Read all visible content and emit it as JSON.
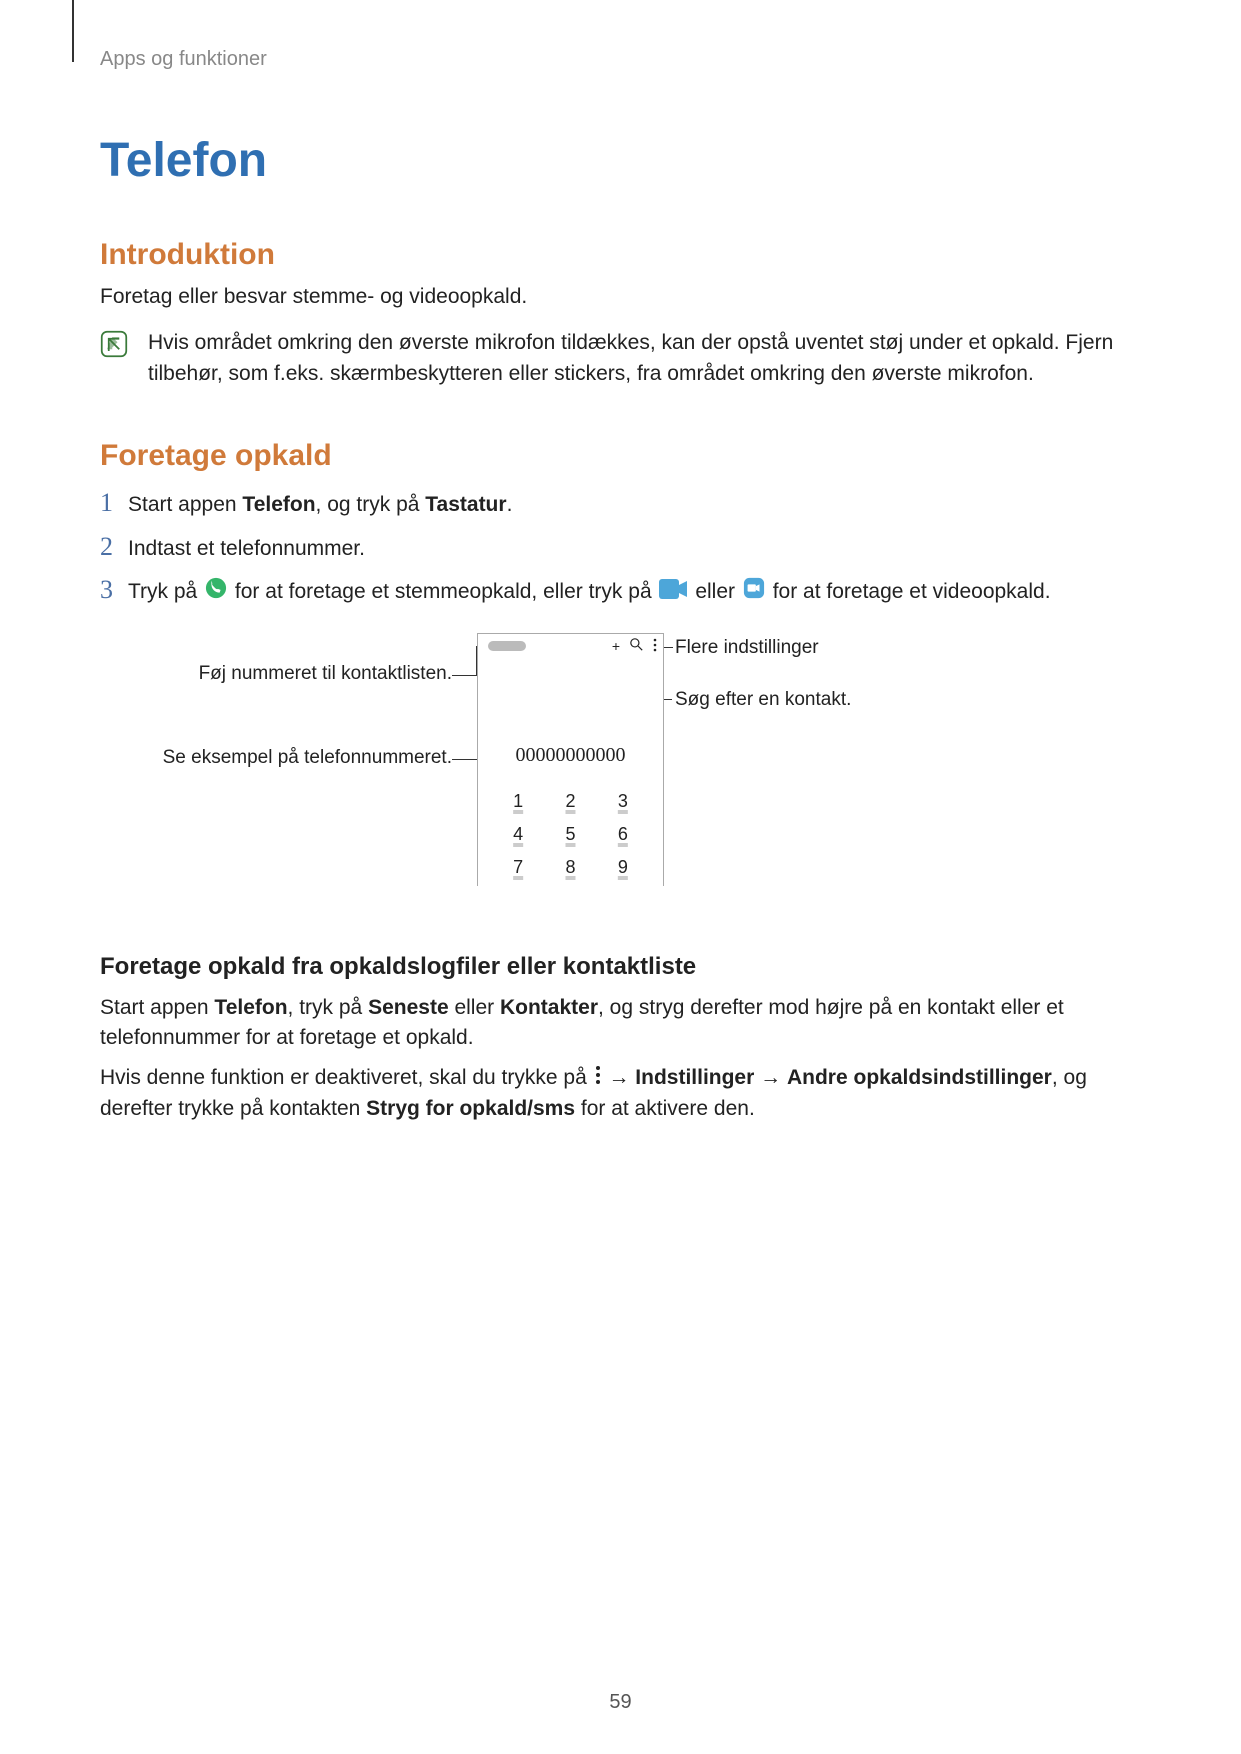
{
  "breadcrumb": "Apps og funktioner",
  "title": "Telefon",
  "section_intro": {
    "heading": "Introduktion",
    "lead": "Foretag eller besvar stemme- og videoopkald.",
    "note": "Hvis området omkring den øverste mikrofon tildækkes, kan der opstå uventet støj under et opkald. Fjern tilbehør, som f.eks. skærmbeskytteren eller stickers, fra området omkring den øverste mikrofon."
  },
  "section_make_call": {
    "heading": "Foretage opkald",
    "steps": [
      {
        "num": "1",
        "pre": "Start appen ",
        "bold1": "Telefon",
        "mid1": ", og tryk på ",
        "bold2": "Tastatur",
        "end": "."
      },
      {
        "num": "2",
        "text": "Indtast et telefonnummer."
      },
      {
        "num": "3",
        "pre": "Tryk på ",
        "after_call_icon": " for at foretage et stemmeopkald, eller tryk på ",
        "after_video1": " eller ",
        "after_video2": " for at foretage et videoopkald."
      }
    ]
  },
  "diagram": {
    "label_add_contact": "Føj nummeret til kontaktlisten.",
    "label_preview_number": "Se eksempel på telefonnummeret.",
    "label_more_options": "Flere indstillinger",
    "label_search_contact": "Søg efter en kontakt.",
    "displayed_number": "00000000000",
    "topbar": {
      "plus": "+",
      "search": "search-icon",
      "menu": "more-icon"
    },
    "keys": [
      "1",
      "2",
      "3",
      "4",
      "5",
      "6",
      "7",
      "8",
      "9"
    ]
  },
  "section_logs": {
    "heading": "Foretage opkald fra opkaldslogfiler eller kontaktliste",
    "para1_pre": "Start appen ",
    "para1_b1": "Telefon",
    "para1_mid1": ", tryk på ",
    "para1_b2": "Seneste",
    "para1_mid2": " eller ",
    "para1_b3": "Kontakter",
    "para1_end": ", og stryg derefter mod højre på en kontakt eller et telefonnummer for at foretage et opkald.",
    "para2_pre": "Hvis denne funktion er deaktiveret, skal du trykke på ",
    "arrow": "→",
    "para2_b1": "Indstillinger",
    "para2_b2": "Andre opkaldsindstillinger",
    "para2_mid": ", og derefter trykke på kontakten ",
    "para2_b3": "Stryg for opkald/sms",
    "para2_end": " for at aktivere den."
  },
  "page_number": "59"
}
